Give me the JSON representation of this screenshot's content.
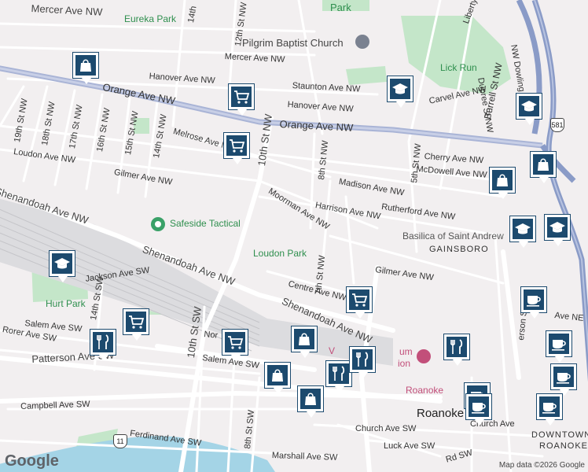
{
  "colors": {
    "background": "#f2eff0",
    "park": "#c4e6c9",
    "water": "#a4d4e6",
    "rail": "#dcdcdf",
    "highway": "#8a9bc7",
    "main_road": "#ffffff",
    "marker": "#1c4a6e",
    "poi_green": "#3aa168",
    "museum_pink": "#c24f7a"
  },
  "labels": {
    "mercer_ave_nw_top": "Mercer Ave NW",
    "mercer_ave_nw": "Mercer Ave NW",
    "eureka_park": "Eureka Park",
    "park_top": "Park",
    "pilgrim_baptist": "Pilgrim Baptist Church",
    "hanover_ave_nw": "Hanover Ave NW",
    "hanover_ave_nw_2": "Hanover Ave NW",
    "staunton_ave_nw": "Staunton Ave NW",
    "lick_run": "Lick Run",
    "carvel_ave_nw": "Carvel Ave NW",
    "burrell_st_nw": "Burrell St NW",
    "dupree_st_nw": "Dupree St NW",
    "nw_dowling": "NW Dowling St",
    "orange_ave_nw_left": "Orange Ave NW",
    "orange_ave_nw_right": "Orange Ave NW",
    "liberty": "Liberty",
    "st_19": "19th St NW",
    "st_18": "18th St NW",
    "st_17": "17th St NW",
    "st_16": "16th St NW",
    "st_15": "15th St NW",
    "st_14": "14th St NW",
    "st_14_top": "14th",
    "st_12": "12th St NW",
    "melrose_ave_nw": "Melrose Ave NW",
    "cherry_ave_nw": "Cherry Ave NW",
    "mcdowell_ave_nw": "McDowell Ave NW",
    "madison_ave_nw": "Madison Ave NW",
    "loudon_ave_nw": "Loudon Ave NW",
    "gilmer_ave_nw": "Gilmer Ave NW",
    "gilmer_ave_nw_2": "Gilmer Ave NW",
    "st_10_nw": "10th St NW",
    "st_8_nw": "8th St NW",
    "st_7_nw": "7th St NW",
    "st_5_nw": "5th St NW",
    "moorman_ave_nw": "Moorman Ave NW",
    "harrison_ave_nw": "Harrison Ave NW",
    "rutherford_ave_nw": "Rutherford Ave NW",
    "basilica": "Basilica of Saint Andrew",
    "gainsboro": "GAINSBORO",
    "safeside": "Safeside Tactical",
    "shenandoah_left": "Shenandoah Ave NW",
    "shenandoah_mid": "Shenandoah Ave NW",
    "shenandoah_right": "Shenandoah Ave NW",
    "loudon_park": "Loudon Park",
    "centre_ave_nw": "Centre Ave NW",
    "jackson_ave_sw": "Jackson Ave SW",
    "hurt_park": "Hurt Park",
    "salem_ave_sw": "Salem Ave SW",
    "salem_ave_sw_2": "Salem Ave SW",
    "rorer_ave_sw": "Rorer Ave SW",
    "norfolk_ave": "Nor",
    "patterson_ave_sw": "Patterson Ave SW",
    "campbell_ave_sw": "Campbell Ave SW",
    "ferdinand_ave_sw": "Ferdinand Ave SW",
    "marshall_ave_sw": "Marshall Ave SW",
    "st_10_sw": "10th St SW",
    "st_14_sw": "14th St SW",
    "st_8_sw": "8th St SW",
    "roanoke_museum": "Roanoke",
    "virginia_museum": "V",
    "museum_text": "um",
    "museum_text2": "ion",
    "roanoke_bold": "Roanoke",
    "church_ave_sw": "Church Ave SW",
    "luck_ave_sw": "Luck Ave SW",
    "church_ave_short": "Church Ave",
    "downtown": "DOWNTOWN",
    "roanoke_caps": "ROANOKE",
    "ave_ne": "Ave NE",
    "jefferson_st": "erson St",
    "rd_sw": "Rd SW",
    "hwy_581": "581",
    "hwy_11": "11"
  },
  "markers": [
    {
      "icon": "shopping-bag-icon"
    },
    {
      "icon": "shopping-cart-icon"
    },
    {
      "icon": "shopping-cart-icon"
    },
    {
      "icon": "school-icon"
    },
    {
      "icon": "school-icon"
    },
    {
      "icon": "shopping-bag-icon"
    },
    {
      "icon": "shopping-bag-icon"
    },
    {
      "icon": "school-icon"
    },
    {
      "icon": "school-icon"
    },
    {
      "icon": "school-icon"
    },
    {
      "icon": "shopping-cart-icon"
    },
    {
      "icon": "shopping-cart-icon"
    },
    {
      "icon": "restaurant-icon"
    },
    {
      "icon": "shopping-cart-icon"
    },
    {
      "icon": "shopping-bag-icon"
    },
    {
      "icon": "restaurant-icon"
    },
    {
      "icon": "restaurant-icon"
    },
    {
      "icon": "shopping-bag-icon"
    },
    {
      "icon": "shopping-bag-icon"
    },
    {
      "icon": "restaurant-icon"
    },
    {
      "icon": "cafe-icon"
    },
    {
      "icon": "cafe-icon"
    },
    {
      "icon": "cafe-icon"
    },
    {
      "icon": "cafe-icon"
    },
    {
      "icon": "cafe-icon"
    },
    {
      "icon": "cafe-icon"
    }
  ],
  "footer": {
    "logo": "Google",
    "attribution": "Map data ©2026 Google"
  }
}
